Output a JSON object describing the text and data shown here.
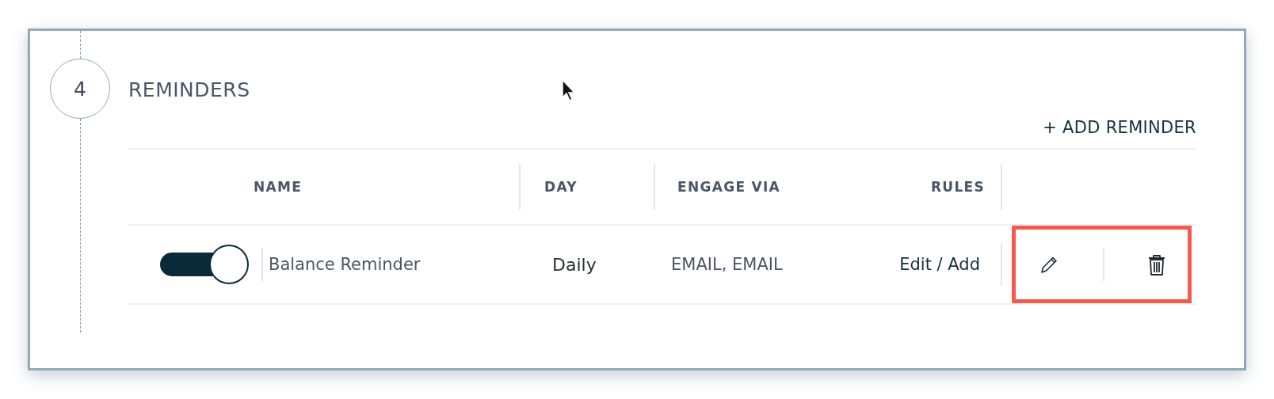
{
  "step": {
    "number": "4",
    "title": "REMINDERS"
  },
  "add_button": "+ ADD REMINDER",
  "columns": [
    "NAME",
    "DAY",
    "ENGAGE VIA",
    "RULES"
  ],
  "rows": [
    {
      "on": true,
      "name": "Balance Reminder",
      "day": "Daily",
      "engage_via": "EMAIL, EMAIL",
      "rules": "Edit / Add",
      "actions_highlighted": true
    }
  ]
}
